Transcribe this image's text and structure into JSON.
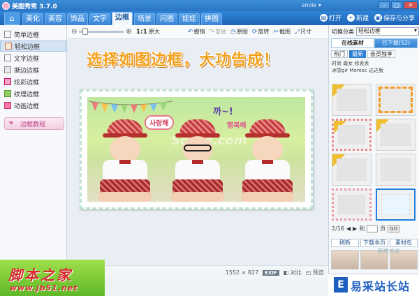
{
  "window": {
    "title": "美图秀秀 3.7.0",
    "user": "smile ▾",
    "controls": [
      "–",
      "□",
      "✕"
    ]
  },
  "nav": {
    "home_icon": "home-icon",
    "tabs": [
      {
        "label": "美化"
      },
      {
        "label": "美容"
      },
      {
        "label": "饰品"
      },
      {
        "label": "文字"
      },
      {
        "label": "边框",
        "active": true
      },
      {
        "label": "场景"
      },
      {
        "label": "闪图"
      },
      {
        "label": "娃娃"
      },
      {
        "label": "拼图"
      }
    ],
    "right": {
      "open": "打开",
      "new": "新建",
      "save": "保存与分享"
    }
  },
  "sidebar": {
    "items": [
      {
        "label": "简单边框"
      },
      {
        "label": "轻松边框",
        "active": true
      },
      {
        "label": "文字边框"
      },
      {
        "label": "撕边边框"
      },
      {
        "label": "炫彩边框"
      },
      {
        "label": "纹理边框"
      },
      {
        "label": "动画边框"
      }
    ],
    "tutorial": "边框教程"
  },
  "toolbar": {
    "ratio": "1:1",
    "original_size": "原大",
    "undo": "撤销",
    "redo": "重做",
    "original": "原图",
    "rotate": "旋转",
    "crop": "截图",
    "size": "尺寸",
    "zoom_progress": 0.08
  },
  "canvas": {
    "headline": "选择如图边框，大功告成！",
    "watermark": "SooTe.com",
    "sticker_hangul_1": "사랑해",
    "sticker_hangul_2": "까~!",
    "sticker_hangul_3": "행복해"
  },
  "status": {
    "dimensions": "1552 × 827",
    "exif": "EXIF",
    "compare": "对比",
    "preview": "预览"
  },
  "rightpanel": {
    "category_label": "切换分类",
    "category_value": "轻松边框",
    "source_tabs": [
      {
        "label": "在线素材",
        "active": true
      },
      {
        "label": "已下载(52)"
      }
    ],
    "filters": [
      {
        "label": "热门"
      },
      {
        "label": "最新",
        "active": true
      },
      {
        "label": "会员独享"
      }
    ],
    "tags_line1": "时尚 森女 修丢丢",
    "tags_line2": "冰雪gir Momoc 达达兔",
    "page": {
      "current": "2/16",
      "goto_label": "到",
      "page_label": "页",
      "go": "GO"
    },
    "actions": {
      "refresh": "刷新",
      "download": "下载本页",
      "library": "素材包"
    }
  },
  "watermarks": {
    "left_big": "脚本之家",
    "left_url": "www.jb51.net",
    "right_text": "易采站长站",
    "right_logo": "E",
    "right_top": "软件大全"
  },
  "colors": {
    "accent": "#2f84d6",
    "headline": "#f2a11d",
    "selected_frame": "#f39c28"
  }
}
